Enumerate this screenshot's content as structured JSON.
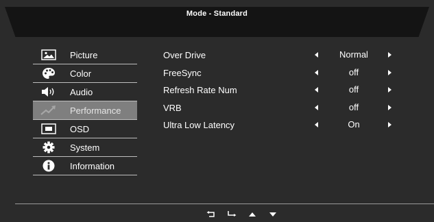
{
  "header": {
    "title": "Mode - Standard"
  },
  "nav": {
    "items": [
      {
        "label": "Picture",
        "icon": "picture-icon",
        "selected": false
      },
      {
        "label": "Color",
        "icon": "palette-icon",
        "selected": false
      },
      {
        "label": "Audio",
        "icon": "speaker-icon",
        "selected": false
      },
      {
        "label": "Performance",
        "icon": "performance-icon",
        "selected": true
      },
      {
        "label": "OSD",
        "icon": "osd-icon",
        "selected": false
      },
      {
        "label": "System",
        "icon": "gear-icon",
        "selected": false
      },
      {
        "label": "Information",
        "icon": "info-icon",
        "selected": false
      }
    ]
  },
  "settings": {
    "rows": [
      {
        "label": "Over Drive",
        "value": "Normal"
      },
      {
        "label": "FreeSync",
        "value": "off"
      },
      {
        "label": "Refresh Rate Num",
        "value": "off"
      },
      {
        "label": "VRB",
        "value": "off"
      },
      {
        "label": "Ultra Low Latency",
        "value": "On"
      }
    ]
  },
  "footer": {
    "icons": [
      "return-icon",
      "enter-icon",
      "up-arrow-icon",
      "down-arrow-icon"
    ]
  },
  "colors": {
    "background": "#2b2b2b",
    "header": "#141414",
    "selected": "#7f7f7f",
    "divider": "#bfbfbf"
  }
}
